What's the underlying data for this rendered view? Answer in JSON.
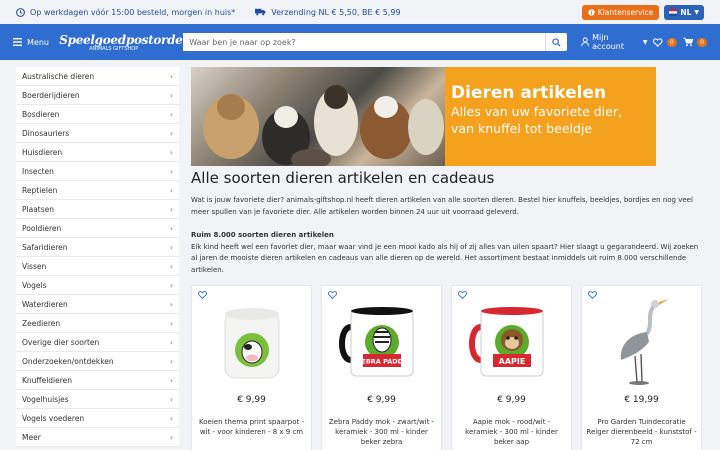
{
  "topbar": {
    "usp1": "Op werkdagen vóór 15:00 besteld, morgen in huis*",
    "usp2": "Verzending NL € 5,50, BE € 5,99",
    "service_label": "Klantenservice",
    "lang_label": "NL"
  },
  "header": {
    "menu_label": "Menu",
    "logo_main": "Speelgoedpostorder",
    "logo_sub": "ANIMALS GIFTSHOP",
    "search_placeholder": "Waar ben je naar op zoek?",
    "account_label": "Mijn account",
    "wishlist_count": "0",
    "cart_count": "0"
  },
  "sidebar": {
    "items": [
      "Australische dieren",
      "Boerderijdieren",
      "Bosdieren",
      "Dinosauriers",
      "Huisdieren",
      "Insecten",
      "Reptielen",
      "Plaatsen",
      "Pooldieren",
      "Safaridieren",
      "Vissen",
      "Vogels",
      "Waterdieren",
      "Zeedieren",
      "Overige dier soorten",
      "Onderzoeken/ontdekken",
      "Knuffeldieren",
      "Vogelhuisjes",
      "Vogels voederen",
      "Meer"
    ]
  },
  "banner": {
    "title": "Dieren artikelen",
    "line1": "Alles van uw favoriete dier,",
    "line2": "van knuffel tot beeldje"
  },
  "page": {
    "heading": "Alle soorten dieren artikelen en cadeaus",
    "intro": "Wat is jouw favoriete dier? animals-giftshop.nl heeft dieren artikelen van alle soorten dieren. Bestel hier knuffels, beeldjes, bordjes en nog veel meer spullen van je favoriete dier. Alle artikelen worden binnen 24 uur uit voorraad geleverd.",
    "subheading": "Ruim 8.000 soorten dieren artikelen",
    "body": "Elk kind heeft wel een favoriet dier, maar waar vind je een mooi kado als hij of zij alles van uilen spaart? Hier slaagt u gegarandeerd. Wij zoeken al jaren de mooiste dieren artikelen en cadeaus van alle dieren op de wereld. Het assortiment bestaat inmiddels uit ruim 8.000 verschillende artikelen."
  },
  "products": [
    {
      "price": "€ 9,99",
      "title": "Koeien thema print spaarpot - wit - voor kinderen - 8 x 9 cm",
      "image_text": ""
    },
    {
      "price": "€ 9,99",
      "title": "Zebra Paddy mok - zwart/wit - keramiek - 300 ml - kinder beker zebra",
      "image_text": "ZEBRA PADDY"
    },
    {
      "price": "€ 9,99",
      "title": "Aapie mok - rood/wit - keramiek - 300 ml - kinder beker aap",
      "image_text": "AAPIE"
    },
    {
      "price": "€ 19,99",
      "title": "Pro Garden Tuindecoratie Reiger dierenbeeld - kunststof - 72 cm",
      "image_text": ""
    }
  ],
  "colors": {
    "header_bg": "#2f6ed0",
    "accent_orange": "#e8701a",
    "banner_orange": "#f4a11d"
  }
}
